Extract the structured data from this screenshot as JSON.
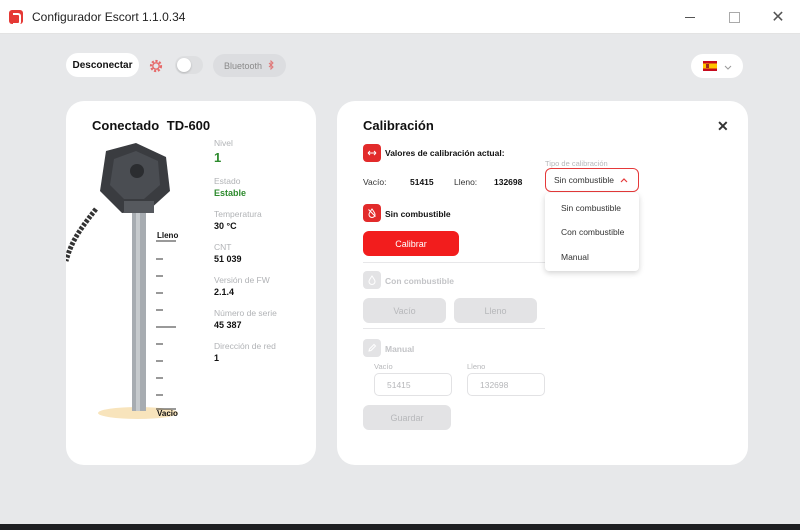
{
  "window": {
    "title": "Configurador Escort 1.1.0.34"
  },
  "toolbar": {
    "disconnect_label": "Desconectar",
    "bluetooth_label": "Bluetooth",
    "settings_icon": "gear-icon",
    "language": "es"
  },
  "device": {
    "title": "Conectado",
    "model": "TD-600",
    "full_label": "Lleno",
    "empty_label": "Vacio",
    "fields": [
      {
        "label": "Nivel",
        "value": "1"
      },
      {
        "label": "Estado",
        "value": "Estable"
      },
      {
        "label": "Temperatura",
        "value": "30 °C"
      },
      {
        "label": "CNT",
        "value": "51 039"
      },
      {
        "label": "Versión de FW",
        "value": "2.1.4"
      },
      {
        "label": "Número de serie",
        "value": "45 387"
      },
      {
        "label": "Dirección de red",
        "value": "1"
      }
    ]
  },
  "calibration": {
    "title": "Calibración",
    "current_section": "Valores de calibración actual:",
    "empty_label": "Vacío:",
    "empty_value": "51415",
    "full_label": "Lleno:",
    "full_value": "132698",
    "type_label": "Tipo de calibración",
    "type_selected": "Sin combustible",
    "type_options": [
      "Sin combustible",
      "Con combustible",
      "Manual"
    ],
    "no_fuel": {
      "title": "Sin combustible",
      "button": "Calibrar"
    },
    "with_fuel": {
      "title": "Con combustible",
      "empty_button": "Vacío",
      "full_button": "Lleno"
    },
    "manual": {
      "title": "Manual",
      "empty_label": "Vacío",
      "empty_placeholder": "51415",
      "full_label": "Lleno",
      "full_placeholder": "132698",
      "save_button": "Guardar"
    }
  },
  "colors": {
    "accent": "#f21d1d",
    "ok": "#2e8b2e"
  }
}
